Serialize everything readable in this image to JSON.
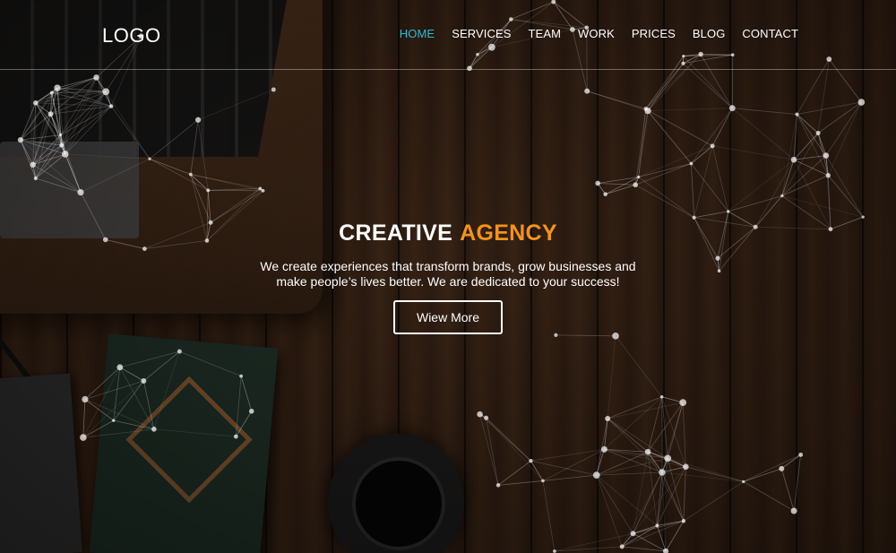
{
  "header": {
    "logo": "LOGO",
    "nav": [
      {
        "label": "HOME",
        "active": true
      },
      {
        "label": "SERVICES",
        "active": false
      },
      {
        "label": "TEAM",
        "active": false
      },
      {
        "label": "WORK",
        "active": false
      },
      {
        "label": "PRICES",
        "active": false
      },
      {
        "label": "BLOG",
        "active": false
      },
      {
        "label": "CONTACT",
        "active": false
      }
    ]
  },
  "hero": {
    "headline_main": "CREATIVE",
    "headline_accent": "AGENCY",
    "tagline": "We create experiences that transform brands, grow businesses and make people’s lives better. We are dedicated to your success!",
    "cta_label": "Wiew More"
  },
  "colors": {
    "accent_orange": "#f39318",
    "nav_active": "#2bbbd0",
    "text": "#ffffff"
  }
}
